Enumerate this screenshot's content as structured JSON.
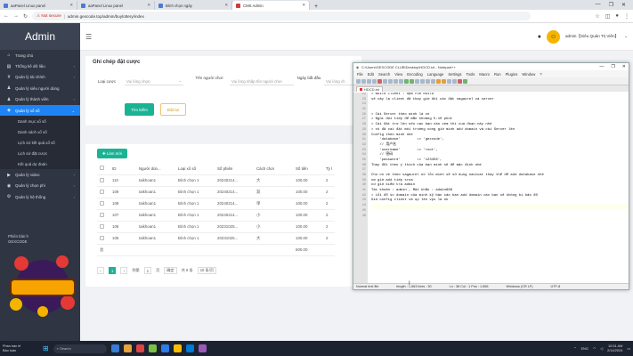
{
  "browser": {
    "tabs": [
      {
        "label": "aaPanel Linux panel",
        "icon": "blue"
      },
      {
        "label": "aaPanel Linux panel",
        "icon": "blue"
      },
      {
        "label": "Bình chọn ngày",
        "icon": "blue"
      },
      {
        "label": "CMS Admin",
        "icon": "red",
        "active": true
      }
    ],
    "new_tab": "+",
    "window_controls": [
      "—",
      "❐",
      "✕"
    ],
    "nav": {
      "back": "←",
      "forward": "→",
      "reload": "↻"
    },
    "warning": "⚠ Not secure",
    "separator": "|",
    "url": "admin.gexcode.top/admin/buylottery/index"
  },
  "sidebar": {
    "logo": "Admin",
    "items": [
      {
        "label": "Trang chủ",
        "icon": "⌂",
        "arrow": ""
      },
      {
        "label": "Thống kê dữ liệu",
        "icon": "▤",
        "arrow": "‹"
      },
      {
        "label": "Quản lý tài chính",
        "icon": "¥",
        "arrow": "‹"
      },
      {
        "label": "Quản lý siêu người dùng",
        "icon": "♟",
        "arrow": ""
      },
      {
        "label": "Quản lý thành viên",
        "icon": "♟",
        "arrow": "‹"
      },
      {
        "label": "Quản lý xổ số",
        "icon": "◈",
        "arrow": "⌄",
        "active": true
      }
    ],
    "sub_items": [
      "Danh mục xổ số",
      "Danh sách xổ số",
      "Lịch sử kết quả xổ số",
      "Lịch sử đặt cược",
      "Kết quả dự đoán"
    ],
    "items_after": [
      {
        "label": "Quản lý video",
        "icon": "▶",
        "arrow": "‹"
      },
      {
        "label": "Quản lý chọn phí",
        "icon": "◉",
        "arrow": "‹"
      },
      {
        "label": "Quản lý hệ thống",
        "icon": "⚙",
        "arrow": "‹"
      }
    ],
    "footer_line1": "Phiên bản h",
    "footer_line2": "GEXCODE"
  },
  "topbar": {
    "menu_icon": "☰",
    "user": "admin【Siêu Quản Trị Viên】",
    "avatar": "☺",
    "caret": "⌄"
  },
  "filter": {
    "title": "Ghi chép đặt cược",
    "lottery_type_label": "Loại cược",
    "lottery_type_placeholder": "Vui lòng chọn",
    "username_label": "Tên người chơi",
    "username_placeholder": "Vui lòng nhập tên người chơi",
    "date_label": "Ngày bắt đầu",
    "date_placeholder": "Vui lòng ch",
    "search_button": "Tìm kiếm",
    "reset_button": "Đặt lại"
  },
  "table": {
    "add_button": "✚ Làm mới",
    "headers": [
      "ID",
      "Người dùn...",
      "Loại xổ số",
      "Số phiên",
      "Cách chơi",
      "Số tiền",
      "Tỷ l"
    ],
    "rows": [
      [
        "110",
        "taikhoan1",
        "Bình chọn 1",
        "20240214...",
        "大",
        "100.00",
        "2"
      ],
      [
        "109",
        "taikhoan1",
        "Bình chọn 1",
        "20240214...",
        "双",
        "100.00",
        "2"
      ],
      [
        "108",
        "taikhoan1",
        "Bình chọn 1",
        "20240214...",
        "单",
        "100.00",
        "2"
      ],
      [
        "107",
        "taikhoan1",
        "Bình chọn 1",
        "20240214...",
        "小",
        "100.00",
        "2"
      ],
      [
        "106",
        "taikhoan1",
        "Bình chọn 1",
        "20231025...",
        "小",
        "100.00",
        "2"
      ],
      [
        "105",
        "taikhoan1",
        "Bình chọn 1",
        "20231025...",
        "大",
        "100.00",
        "2"
      ]
    ],
    "sum_label": "总",
    "sum_value": "600.00",
    "pager": {
      "prev": "‹",
      "current": "1",
      "next": "›",
      "goto_label": "到第",
      "goto_value": "1",
      "page_unit": "页",
      "confirm": "确定",
      "total": "共 6 条",
      "per_page": "10 条/页"
    }
  },
  "notepad": {
    "title": "C:\\Users\\GEXCODE CLUB\\Desktop\\HDCD.txt - Notepad++",
    "controls": [
      "—",
      "❐",
      "✕"
    ],
    "menu": [
      "File",
      "Edit",
      "Search",
      "View",
      "Encoding",
      "Language",
      "Settings",
      "Tools",
      "Macro",
      "Run",
      "Plugins",
      "Window",
      "?"
    ],
    "tab": "HDCD.txt",
    "line_numbers": [
      "22",
      "23",
      "24",
      "25",
      "26",
      "27",
      "28",
      "29",
      "30",
      "31",
      "32",
      "33",
      "34",
      "35",
      "36",
      "37",
      "38",
      "39",
      "40",
      "41",
      "42",
      "43",
      "44",
      "45",
      "46"
    ],
    "lines": [
      "> Build Client : npm run build",
      "sẽ xây lạ client đã thay giờ đối các đặt sagaurel và server",
      "",
      "",
      "> Cài Server theo mình là có",
      "> Ngủi đợi tiếp để mẫn khoảng 5-10 phút",
      "> Cài đặt trợ lên nếu cac bạn cần xem thì cua đoạn này nhé",
      "> có đã cài đặt môi trường song giờ mình add domain và cài Server lên",
      "Config theo mình nhé",
      "    'database'        => 'gexcode',",
      "    // 用户名",
      "    'username'        => 'root',",
      "    // 密码",
      "    'password'        => '123456',",
      "Thay đổi theo ý thích của bạn mình sẽ để mặc định nhé",
      "",
      "Chú có về theo sagaurel nó lỗi mình sẽ sử dụng navicat thay thể để add database nhé",
      "cm giờ add tiếp sroa",
      "cứ giờ kiểm tra admin",
      "Tài khoản : admin , Mật khẩu : admin888",
      "> Lỗi đổ sc domain của mình kỹ bảo cáo bạn add domain các bạn sẽ không bị bảo đổ",
      "Giờ config client và up lên vps là ok",
      "",
      "",
      ""
    ],
    "status": {
      "type": "Normal text file",
      "length": "length : 1,563   lines : 30",
      "pos": "Ln : 38   Col : 1   Pos : 1,566",
      "eol": "Windows (CR LF)",
      "enc": "UTF-8"
    }
  },
  "taskbar": {
    "weather_line1": "Phần bán lẻ",
    "weather_line2": "Bảo toàn",
    "search_placeholder": "Search",
    "tray": "ENG",
    "time": "10:51 AM",
    "date": "2/14/2024"
  },
  "colors": {
    "sidebar": "#2f3542",
    "active": "#1e84f6",
    "accent": "#1ab394"
  }
}
